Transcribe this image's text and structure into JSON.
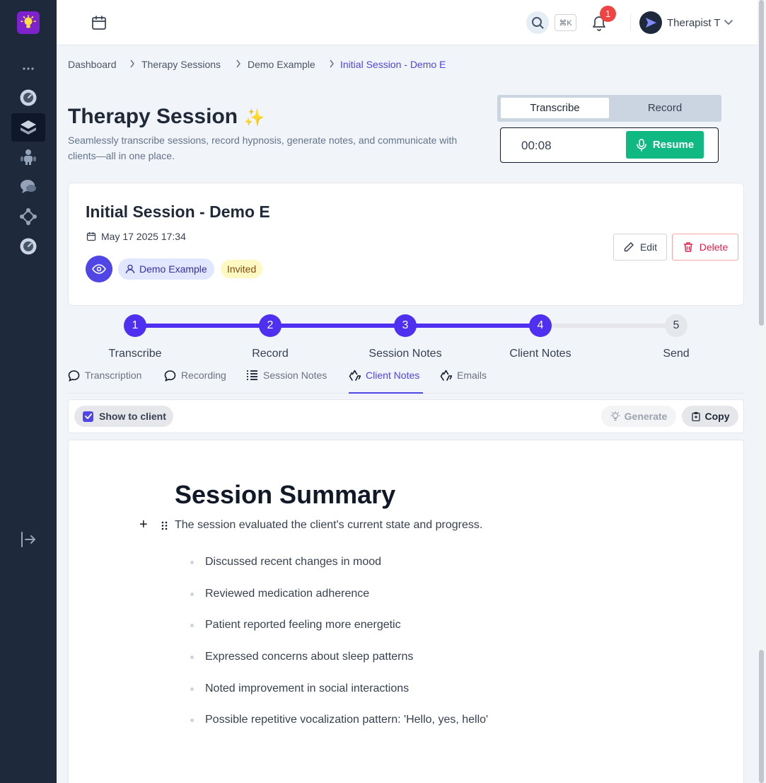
{
  "header": {
    "search_shortcut": "⌘K",
    "notification_count": "1",
    "user_name": "Therapist T"
  },
  "breadcrumb": [
    "Dashboard",
    "Therapy Sessions",
    "Demo Example",
    "Initial Session - Demo E"
  ],
  "page": {
    "title": "Therapy Session",
    "title_emoji": "✨",
    "subtitle": "Seamlessly transcribe sessions, record hypnosis, generate notes, and communicate with clients—all in one place."
  },
  "mode_toggle": {
    "options": [
      "Transcribe",
      "Record"
    ],
    "selected": "Transcribe"
  },
  "recorder": {
    "elapsed": "00:08",
    "resume_label": "Resume"
  },
  "session": {
    "title": "Initial Session - Demo E",
    "date": "May 17 2025 17:34",
    "client": "Demo Example",
    "status": "Invited",
    "edit_label": "Edit",
    "delete_label": "Delete"
  },
  "stepper": {
    "steps": [
      {
        "number": "1",
        "label": "Transcribe"
      },
      {
        "number": "2",
        "label": "Record"
      },
      {
        "number": "3",
        "label": "Session Notes"
      },
      {
        "number": "4",
        "label": "Client Notes"
      },
      {
        "number": "5",
        "label": "Send"
      }
    ],
    "current": 4
  },
  "tabs": [
    {
      "label": "Transcription",
      "icon": "chat-bubble-icon"
    },
    {
      "label": "Recording",
      "icon": "chat-bubble-icon"
    },
    {
      "label": "Session Notes",
      "icon": "list-icon"
    },
    {
      "label": "Client Notes",
      "icon": "recycle-icon"
    },
    {
      "label": "Emails",
      "icon": "recycle-icon"
    }
  ],
  "active_tab": "Client Notes",
  "editor_toolbar": {
    "show_to_client_label": "Show to client",
    "show_to_client_checked": true,
    "generate_label": "Generate",
    "copy_label": "Copy"
  },
  "document": {
    "heading": "Session Summary",
    "intro": "The session evaluated the client's current state and progress.",
    "bullets": [
      "Discussed recent changes in mood",
      "Reviewed medication adherence",
      "Patient reported feeling more energetic",
      "Expressed concerns about sleep patterns",
      "Noted improvement in social interactions",
      "Possible repetitive vocalization pattern: 'Hello, yes, hello'"
    ]
  },
  "colors": {
    "sidebar": "#1e293b",
    "accent": "#4f46e5",
    "step_active": "#4f2ff0",
    "resume_green": "#10b981",
    "delete_red": "#e11d48"
  }
}
